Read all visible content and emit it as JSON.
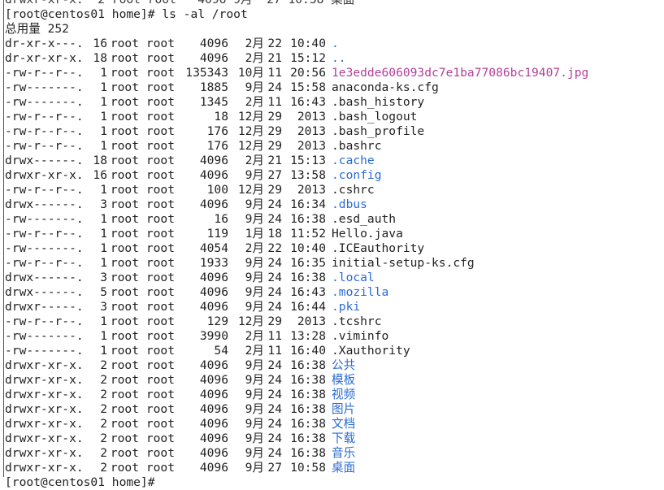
{
  "terminal": {
    "top_partial_line": "drwxr-xr-x.  2 root root   4096 9月  27 10:58 桌面",
    "prompt_command": "[root@centos01 home]# ls -al /root",
    "total": "总用量 252",
    "bottom_partial_line": "[root@centos01 home]# ",
    "rows": [
      {
        "perm": "dr-xr-x---.",
        "links": "16",
        "owner": "root",
        "group": "root",
        "size": "4096",
        "month": "2月",
        "day": "22",
        "time": "10:40",
        "name": ".",
        "kind": "dir"
      },
      {
        "perm": "dr-xr-xr-x.",
        "links": "18",
        "owner": "root",
        "group": "root",
        "size": "4096",
        "month": "2月",
        "day": "21",
        "time": "15:12",
        "name": "..",
        "kind": "dir"
      },
      {
        "perm": "-rw-r--r--.",
        "links": "1",
        "owner": "root",
        "group": "root",
        "size": "135343",
        "month": "10月",
        "day": "11",
        "time": "20:56",
        "name": "1e3edde606093dc7e1ba77086bc19407.jpg",
        "kind": "img"
      },
      {
        "perm": "-rw-------.",
        "links": "1",
        "owner": "root",
        "group": "root",
        "size": "1885",
        "month": "9月",
        "day": "24",
        "time": "15:58",
        "name": "anaconda-ks.cfg",
        "kind": "file"
      },
      {
        "perm": "-rw-------.",
        "links": "1",
        "owner": "root",
        "group": "root",
        "size": "1345",
        "month": "2月",
        "day": "11",
        "time": "16:43",
        "name": ".bash_history",
        "kind": "file"
      },
      {
        "perm": "-rw-r--r--.",
        "links": "1",
        "owner": "root",
        "group": "root",
        "size": "18",
        "month": "12月",
        "day": "29",
        "time": "2013",
        "name": ".bash_logout",
        "kind": "file"
      },
      {
        "perm": "-rw-r--r--.",
        "links": "1",
        "owner": "root",
        "group": "root",
        "size": "176",
        "month": "12月",
        "day": "29",
        "time": "2013",
        "name": ".bash_profile",
        "kind": "file"
      },
      {
        "perm": "-rw-r--r--.",
        "links": "1",
        "owner": "root",
        "group": "root",
        "size": "176",
        "month": "12月",
        "day": "29",
        "time": "2013",
        "name": ".bashrc",
        "kind": "file"
      },
      {
        "perm": "drwx------.",
        "links": "18",
        "owner": "root",
        "group": "root",
        "size": "4096",
        "month": "2月",
        "day": "21",
        "time": "15:13",
        "name": ".cache",
        "kind": "dir"
      },
      {
        "perm": "drwxr-xr-x.",
        "links": "16",
        "owner": "root",
        "group": "root",
        "size": "4096",
        "month": "9月",
        "day": "27",
        "time": "13:58",
        "name": ".config",
        "kind": "dir"
      },
      {
        "perm": "-rw-r--r--.",
        "links": "1",
        "owner": "root",
        "group": "root",
        "size": "100",
        "month": "12月",
        "day": "29",
        "time": "2013",
        "name": ".cshrc",
        "kind": "file"
      },
      {
        "perm": "drwx------.",
        "links": "3",
        "owner": "root",
        "group": "root",
        "size": "4096",
        "month": "9月",
        "day": "24",
        "time": "16:34",
        "name": ".dbus",
        "kind": "dir"
      },
      {
        "perm": "-rw-------.",
        "links": "1",
        "owner": "root",
        "group": "root",
        "size": "16",
        "month": "9月",
        "day": "24",
        "time": "16:38",
        "name": ".esd_auth",
        "kind": "file"
      },
      {
        "perm": "-rw-r--r--.",
        "links": "1",
        "owner": "root",
        "group": "root",
        "size": "119",
        "month": "1月",
        "day": "18",
        "time": "11:52",
        "name": "Hello.java",
        "kind": "file"
      },
      {
        "perm": "-rw-------.",
        "links": "1",
        "owner": "root",
        "group": "root",
        "size": "4054",
        "month": "2月",
        "day": "22",
        "time": "10:40",
        "name": ".ICEauthority",
        "kind": "file"
      },
      {
        "perm": "-rw-r--r--.",
        "links": "1",
        "owner": "root",
        "group": "root",
        "size": "1933",
        "month": "9月",
        "day": "24",
        "time": "16:35",
        "name": "initial-setup-ks.cfg",
        "kind": "file"
      },
      {
        "perm": "drwx------.",
        "links": "3",
        "owner": "root",
        "group": "root",
        "size": "4096",
        "month": "9月",
        "day": "24",
        "time": "16:38",
        "name": ".local",
        "kind": "dir"
      },
      {
        "perm": "drwx------.",
        "links": "5",
        "owner": "root",
        "group": "root",
        "size": "4096",
        "month": "9月",
        "day": "24",
        "time": "16:43",
        "name": ".mozilla",
        "kind": "dir"
      },
      {
        "perm": "drwxr-----.",
        "links": "3",
        "owner": "root",
        "group": "root",
        "size": "4096",
        "month": "9月",
        "day": "24",
        "time": "16:44",
        "name": ".pki",
        "kind": "dir"
      },
      {
        "perm": "-rw-r--r--.",
        "links": "1",
        "owner": "root",
        "group": "root",
        "size": "129",
        "month": "12月",
        "day": "29",
        "time": "2013",
        "name": ".tcshrc",
        "kind": "file"
      },
      {
        "perm": "-rw-------.",
        "links": "1",
        "owner": "root",
        "group": "root",
        "size": "3990",
        "month": "2月",
        "day": "11",
        "time": "13:28",
        "name": ".viminfo",
        "kind": "file"
      },
      {
        "perm": "-rw-------.",
        "links": "1",
        "owner": "root",
        "group": "root",
        "size": "54",
        "month": "2月",
        "day": "11",
        "time": "16:40",
        "name": ".Xauthority",
        "kind": "file"
      },
      {
        "perm": "drwxr-xr-x.",
        "links": "2",
        "owner": "root",
        "group": "root",
        "size": "4096",
        "month": "9月",
        "day": "24",
        "time": "16:38",
        "name": "公共",
        "kind": "dir"
      },
      {
        "perm": "drwxr-xr-x.",
        "links": "2",
        "owner": "root",
        "group": "root",
        "size": "4096",
        "month": "9月",
        "day": "24",
        "time": "16:38",
        "name": "模板",
        "kind": "dir"
      },
      {
        "perm": "drwxr-xr-x.",
        "links": "2",
        "owner": "root",
        "group": "root",
        "size": "4096",
        "month": "9月",
        "day": "24",
        "time": "16:38",
        "name": "视频",
        "kind": "dir"
      },
      {
        "perm": "drwxr-xr-x.",
        "links": "2",
        "owner": "root",
        "group": "root",
        "size": "4096",
        "month": "9月",
        "day": "24",
        "time": "16:38",
        "name": "图片",
        "kind": "dir"
      },
      {
        "perm": "drwxr-xr-x.",
        "links": "2",
        "owner": "root",
        "group": "root",
        "size": "4096",
        "month": "9月",
        "day": "24",
        "time": "16:38",
        "name": "文档",
        "kind": "dir"
      },
      {
        "perm": "drwxr-xr-x.",
        "links": "2",
        "owner": "root",
        "group": "root",
        "size": "4096",
        "month": "9月",
        "day": "24",
        "time": "16:38",
        "name": "下载",
        "kind": "dir"
      },
      {
        "perm": "drwxr-xr-x.",
        "links": "2",
        "owner": "root",
        "group": "root",
        "size": "4096",
        "month": "9月",
        "day": "24",
        "time": "16:38",
        "name": "音乐",
        "kind": "dir"
      },
      {
        "perm": "drwxr-xr-x.",
        "links": "2",
        "owner": "root",
        "group": "root",
        "size": "4096",
        "month": "9月",
        "day": "27",
        "time": "10:58",
        "name": "桌面",
        "kind": "dir"
      }
    ]
  },
  "colors": {
    "background": "#ffffff",
    "text": "#222222",
    "directory": "#2a6bd6",
    "image_file": "#b3409a"
  }
}
